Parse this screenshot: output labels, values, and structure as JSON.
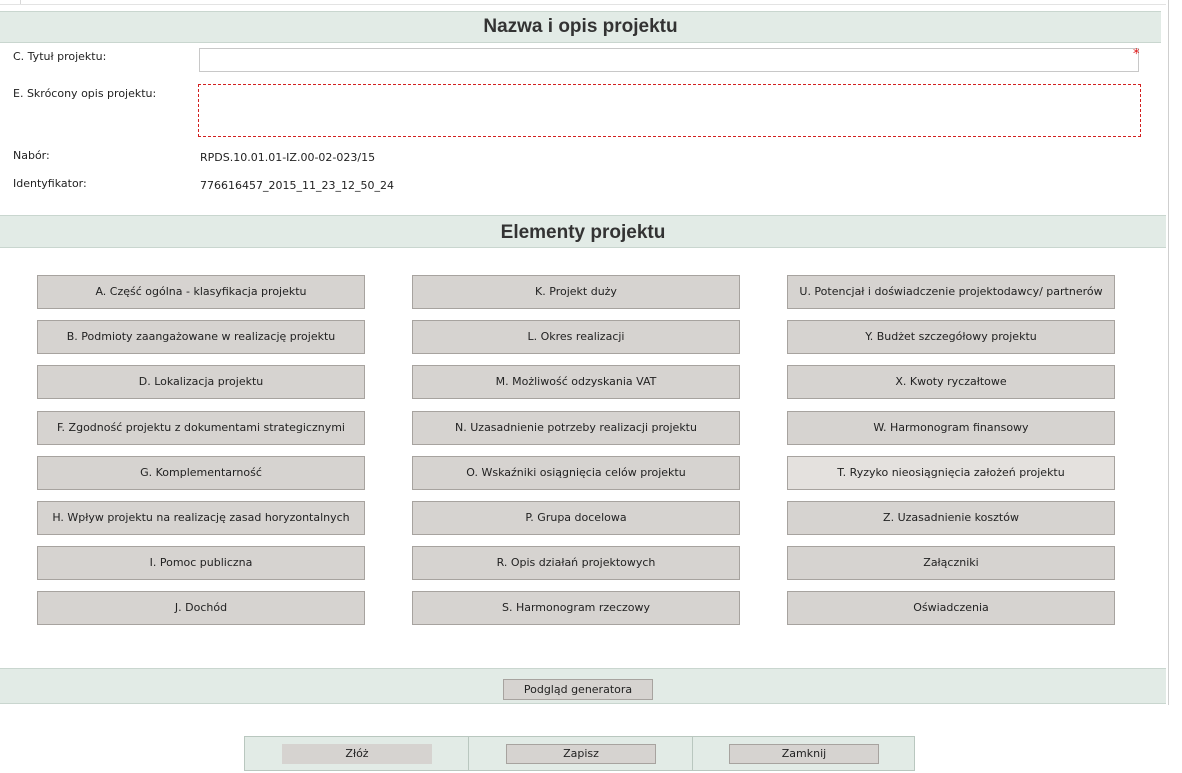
{
  "section_project": {
    "title": "Nazwa i opis projektu",
    "title_label": "C. Tytuł projektu:",
    "title_value": "",
    "title_required_mark": "*",
    "description_label": "E. Skrócony opis projektu:",
    "description_value": "",
    "nabor_label": "Nabór:",
    "nabor_value": "RPDS.10.01.01-IZ.00-02-023/15",
    "id_label": "Identyfikator:",
    "id_value": "776616457_2015_11_23_12_50_24"
  },
  "section_elements": {
    "title": "Elementy projektu",
    "columns": [
      [
        "A. Część ogólna - klasyfikacja projektu",
        "B. Podmioty zaangażowane w realizację projektu",
        "D. Lokalizacja projektu",
        "F. Zgodność projektu z dokumentami strategicznymi",
        "G. Komplementarność",
        "H. Wpływ projektu na realizację zasad horyzontalnych",
        "I. Pomoc publiczna",
        "J. Dochód"
      ],
      [
        "K. Projekt duży",
        "L. Okres realizacji",
        "M. Możliwość odzyskania VAT",
        "N. Uzasadnienie potrzeby realizacji projektu",
        "O. Wskaźniki osiągnięcia celów projektu",
        "P. Grupa docelowa",
        "R. Opis działań projektowych",
        "S. Harmonogram rzeczowy"
      ],
      [
        "U. Potencjał i doświadczenie projektodawcy/ partnerów",
        "Y. Budżet szczegółowy projektu",
        "X. Kwoty ryczałtowe",
        "W. Harmonogram finansowy",
        "T. Ryzyko nieosiągnięcia założeń projektu",
        "Z. Uzasadnienie kosztów",
        "Załączniki",
        "Oświadczenia"
      ]
    ]
  },
  "generator": {
    "preview_label": "Podgląd generatora"
  },
  "actions": {
    "submit_label": "Złóż",
    "save_label": "Zapisz",
    "close_label": "Zamknij"
  }
}
